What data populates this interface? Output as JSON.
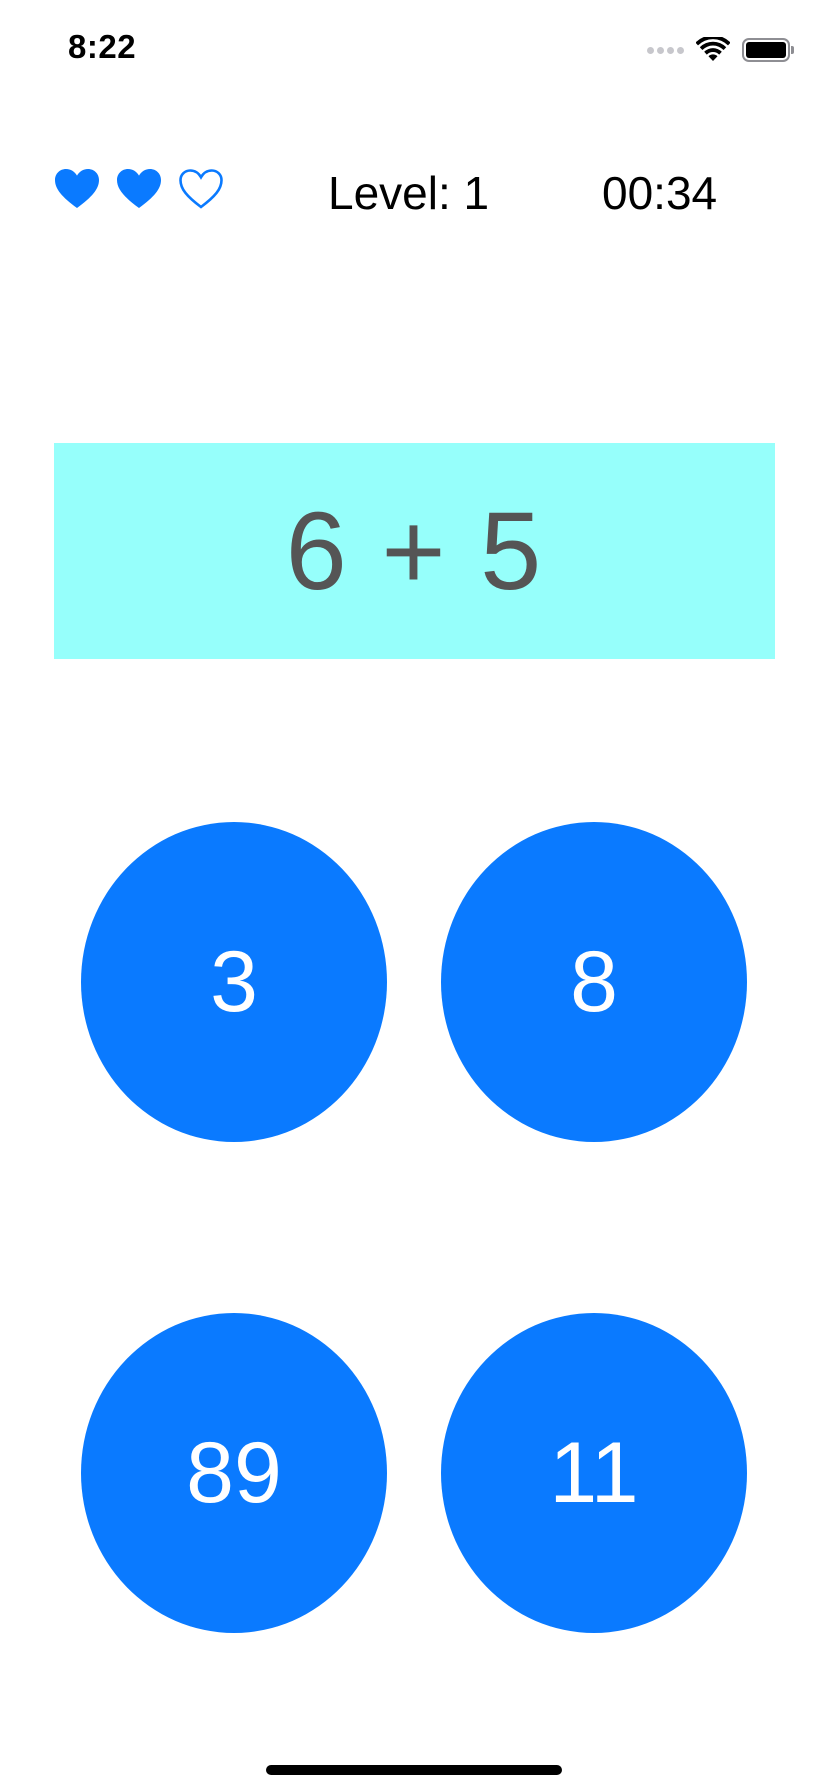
{
  "status_bar": {
    "time": "8:22",
    "icons": [
      "cellular-signal-icon",
      "wifi-icon",
      "battery-icon"
    ],
    "battery_level": 1.0
  },
  "game": {
    "lives_total": 3,
    "lives_remaining": 2,
    "level_label": "Level: 1",
    "timer": "00:34"
  },
  "question": {
    "text": "6 + 5"
  },
  "answers": [
    {
      "label": "3"
    },
    {
      "label": "8"
    },
    {
      "label": "89"
    },
    {
      "label": "11"
    }
  ],
  "colors": {
    "accent": "#0a7aff",
    "question_background": "#96fffb",
    "question_text": "#555555",
    "answer_text": "#ffffff"
  }
}
